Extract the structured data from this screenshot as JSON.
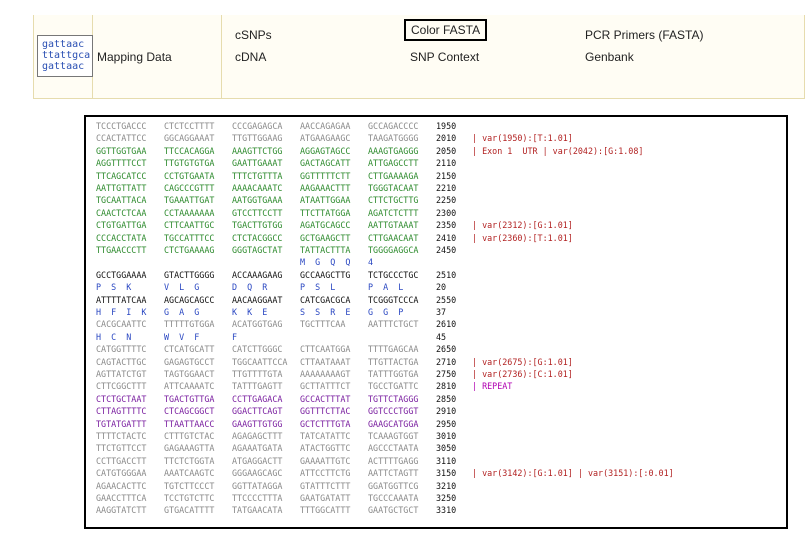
{
  "logo": {
    "lines": [
      "gattaac",
      "ttattgca",
      "gattaac"
    ]
  },
  "nav": {
    "mapping": "Mapping Data",
    "csnps": "cSNPs",
    "cdna": "cDNA",
    "color_fasta": "Color FASTA",
    "snp_context": "SNP Context",
    "pcr_primers": "PCR Primers (FASTA)",
    "genbank": "Genbank"
  },
  "sequence_rows": [
    {
      "seq": [
        "TCCCTGACCC",
        "CTCTCCTTTT",
        "CCCGAGAGCA",
        "AACCAGAGAA",
        "GCCAGACCCC"
      ],
      "pos": "1950",
      "note": "",
      "color": "gray"
    },
    {
      "seq": [
        "CCACTATTCC",
        "GGCAGGAAAT",
        "TTGTTGGAAG",
        "ATGAAGAAGC",
        "TAAGATGGGG"
      ],
      "pos": "2010",
      "note": "var(1950):[T:1.01]",
      "color": "gray",
      "noteColor": "red"
    },
    {
      "seq": [
        "GGTTGGTGAA",
        "TTCCACAGGA",
        "AAAGTTCTGG",
        "AGGAGTAGCC",
        "AAAGTGAGGG"
      ],
      "pos": "2050",
      "note": "Exon 1  UTR | var(2042):[G:1.08]",
      "color": "green",
      "noteColor": "red"
    },
    {
      "seq": [
        "AGGTTTTCCT",
        "TTGTGTGTGA",
        "GAATTGAAAT",
        "GACTAGCATT",
        "ATTGAGCCTT"
      ],
      "pos": "2110",
      "note": "",
      "color": "green"
    },
    {
      "seq": [
        "TTCAGCATCC",
        "CCTGTGAATA",
        "TTTCTGTTTA",
        "GGTTTTTCTT",
        "CTTGAAAAGA"
      ],
      "pos": "2150",
      "note": "",
      "color": "green"
    },
    {
      "seq": [
        "AATTGTTATT",
        "CAGCCCGTTT",
        "AAAACAAATC",
        "AAGAAACTTT",
        "TGGGTACAAT"
      ],
      "pos": "2210",
      "note": "",
      "color": "green"
    },
    {
      "seq": [
        "TGCAATTACA",
        "TGAAATTGAT",
        "AATGGTGAAA",
        "ATAATTGGAA",
        "CTTCTGCTTG"
      ],
      "pos": "2250",
      "note": "",
      "color": "green"
    },
    {
      "seq": [
        "CAACTCTCAA",
        "CCTAAAAAAA",
        "GTCCTTCCTT",
        "TTCTTATGGA",
        "AGATCTCTTT"
      ],
      "pos": "2300",
      "note": "",
      "color": "green"
    },
    {
      "seq": [
        "CTGTGATTGA",
        "CTTCAATTGC",
        "TGACTTGTGG",
        "AGATGCAGCC",
        "AATTGTAAAT"
      ],
      "pos": "2350",
      "note": "var(2312):[G:1.01]",
      "color": "green",
      "noteColor": "red"
    },
    {
      "seq": [
        "CCCACCTATA",
        "TGCCATTTCC",
        "CTCTACGGCC",
        "GCTGAAGCTT",
        "CTTGAACAAT"
      ],
      "pos": "2410",
      "note": "var(2360):[T:1.01]",
      "color": "green",
      "noteColor": "red"
    },
    {
      "seq": [
        "TTGAACCCTT",
        "CTCTGAAAAG",
        "GGGTAGCTAT",
        "TATTACTTTA",
        "TGGGGAGGCA"
      ],
      "pos": "2450",
      "note": "",
      "color": "green"
    },
    {
      "seq": [
        "",
        "",
        "",
        "M  G  Q  Q",
        "4"
      ],
      "pos": "",
      "note": "",
      "color": "blue"
    },
    {
      "seq": [
        "GCCTGGAAAA",
        "GTACTTGGGG",
        "ACCAAAGAAG",
        "GCCAAGCTTG",
        "TCTGCCCTGC"
      ],
      "pos": "2510",
      "note": "",
      "color": "black"
    },
    {
      "seq": [
        "P  S  K",
        "V  L  G",
        "D  Q  R",
        "P  S  L",
        "P  A  L"
      ],
      "pos": "20",
      "note": "",
      "color": "blue"
    },
    {
      "seq": [
        "ATTTTATCAA",
        "AGCAGCAGCC",
        "AACAAGGAAT",
        "CATCGACGCA",
        "TCGGGTCCCA"
      ],
      "pos": "2550",
      "note": "",
      "color": "black"
    },
    {
      "seq": [
        "H  F  I  K",
        "G  A  G",
        "K  K  E",
        "S  S  R  E",
        "G  G  P"
      ],
      "pos": "37",
      "note": "",
      "color": "blue"
    },
    {
      "seq": [
        "CACGCAATTC",
        "TTTTTGTGGA",
        "ACATGGTGAG",
        "TGCTTTCAA",
        "AATTTCTGCT"
      ],
      "pos": "2610",
      "note": "",
      "color": "gray"
    },
    {
      "seq": [
        "H  C  N",
        "W  V  F",
        "F",
        "",
        ""
      ],
      "pos": "45",
      "note": "",
      "color": "blue"
    },
    {
      "seq": [
        "CATGGTTTTC",
        "CTCATGCATT",
        "CATCTTGGGC",
        "CTTCAATGGA",
        "TTTTGAGCAA"
      ],
      "pos": "2650",
      "note": "",
      "color": "gray"
    },
    {
      "seq": [
        "CAGTACTTGC",
        "GAGAGTGCCT",
        "TGGCAATTCCA",
        "CTTAATAAAT",
        "TTGTTACTGA"
      ],
      "pos": "2710",
      "note": "var(2675):[G:1.01]",
      "color": "gray",
      "noteColor": "red"
    },
    {
      "seq": [
        "AGTTATCTGT",
        "TAGTGGAACT",
        "TTGTTTTGTA",
        "AAAAAAAAGT",
        "TATTTGGTGA"
      ],
      "pos": "2750",
      "note": "var(2736):[C:1.01]",
      "color": "gray",
      "noteColor": "red"
    },
    {
      "seq": [
        "CTTCGGCTTT",
        "ATTCAAAATC",
        "TATTTGAGTT",
        "GCTTATTTCT",
        "TGCCTGATTC"
      ],
      "pos": "2810",
      "note": "REPEAT",
      "color": "gray",
      "noteColor": "mag"
    },
    {
      "seq": [
        "CTCTGCTAAT",
        "TGACTGTTGA",
        "CCTTGAGACA",
        "GCCACTTTAT",
        "TGTTCTAGGG"
      ],
      "pos": "2850",
      "note": "",
      "color": "purple"
    },
    {
      "seq": [
        "CTTAGTTTTC",
        "CTCAGCGGCT",
        "GGACTTCAGT",
        "GGTTTCTTAC",
        "GGTCCCTGGT"
      ],
      "pos": "2910",
      "note": "",
      "color": "purple"
    },
    {
      "seq": [
        "TGTATGATTT",
        "TTAATTAACC",
        "GAAGTTGTGG",
        "GCTCTTTGTA",
        "GAAGCATGGA"
      ],
      "pos": "2950",
      "note": "",
      "color": "purple"
    },
    {
      "seq": [
        "TTTTCTACTC",
        "CTTTGTCTAC",
        "AGAGAGCTTT",
        "TATCATATTC",
        "TCAAAGTGGT"
      ],
      "pos": "3010",
      "note": "",
      "color": "gray"
    },
    {
      "seq": [
        "TTCTGTTCCT",
        "GAGAAAGTTA",
        "AGAAATGATA",
        "ATACTGGTTC",
        "AGCCCTAATA"
      ],
      "pos": "3050",
      "note": "",
      "color": "gray"
    },
    {
      "seq": [
        "CCTTGACCTT",
        "TTCTCTGGTA",
        "ATGAGGACTT",
        "GAAAATTGTC",
        "ACTTTTGAGG"
      ],
      "pos": "3110",
      "note": "",
      "color": "gray"
    },
    {
      "seq": [
        "CATGTGGGAA",
        "AAATCAAGTC",
        "GGGAAGCAGC",
        "ATTCCTTCTG",
        "AATTCTAGTT"
      ],
      "pos": "3150",
      "note": "var(3142):[G:1.01] | var(3151):[:0.01]",
      "color": "gray",
      "noteColor": "red"
    },
    {
      "seq": [
        "AGAACACTTC",
        "TGTCTTCCCT",
        "GGTTATAGGA",
        "GTATTTCTTT",
        "GGATGGTTCG"
      ],
      "pos": "3210",
      "note": "",
      "color": "gray"
    },
    {
      "seq": [
        "GAACCTTTCA",
        "TCCTGTCTTC",
        "TTCCCCTTTA",
        "GAATGATATT",
        "TGCCCAAATA"
      ],
      "pos": "3250",
      "note": "",
      "color": "gray"
    },
    {
      "seq": [
        "AAGGTATCTT",
        "GTGACATTTT",
        "TATGAACATA",
        "TTTGGCATTT",
        "GAATGCTGCT"
      ],
      "pos": "3310",
      "note": "",
      "color": "gray"
    }
  ]
}
